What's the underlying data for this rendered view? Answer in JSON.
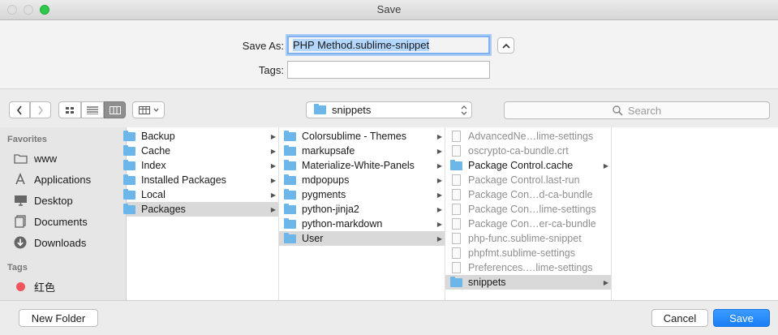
{
  "window": {
    "title": "Save"
  },
  "form": {
    "save_as_label": "Save As:",
    "save_as_value": "PHP Method.sublime-snippet",
    "tags_label": "Tags:",
    "tags_value": ""
  },
  "toolbar": {
    "location": "snippets",
    "search_placeholder": "Search"
  },
  "sidebar": {
    "favorites_header": "Favorites",
    "favorites": [
      {
        "label": "www",
        "icon": "folder-icon"
      },
      {
        "label": "Applications",
        "icon": "applications-icon"
      },
      {
        "label": "Desktop",
        "icon": "desktop-icon"
      },
      {
        "label": "Documents",
        "icon": "documents-icon"
      },
      {
        "label": "Downloads",
        "icon": "downloads-icon"
      }
    ],
    "tags_header": "Tags",
    "tags": [
      {
        "label": "红色",
        "color": "#f2545b"
      }
    ]
  },
  "columns": [
    {
      "items": [
        {
          "label": "Backup",
          "type": "folder"
        },
        {
          "label": "Cache",
          "type": "folder"
        },
        {
          "label": "Index",
          "type": "folder"
        },
        {
          "label": "Installed Packages",
          "type": "folder"
        },
        {
          "label": "Local",
          "type": "folder"
        },
        {
          "label": "Packages",
          "type": "folder",
          "selected": true
        }
      ]
    },
    {
      "items": [
        {
          "label": "Colorsublime - Themes",
          "type": "folder"
        },
        {
          "label": "markupsafe",
          "type": "folder"
        },
        {
          "label": "Materialize-White-Panels",
          "type": "folder"
        },
        {
          "label": "mdpopups",
          "type": "folder"
        },
        {
          "label": "pygments",
          "type": "folder"
        },
        {
          "label": "python-jinja2",
          "type": "folder"
        },
        {
          "label": "python-markdown",
          "type": "folder"
        },
        {
          "label": "User",
          "type": "folder",
          "selected": true
        }
      ]
    },
    {
      "items": [
        {
          "label": "AdvancedNe…lime-settings",
          "type": "file"
        },
        {
          "label": "oscrypto-ca-bundle.crt",
          "type": "file"
        },
        {
          "label": "Package Control.cache",
          "type": "folder"
        },
        {
          "label": "Package Control.last-run",
          "type": "file"
        },
        {
          "label": "Package Con…d-ca-bundle",
          "type": "file"
        },
        {
          "label": "Package Con…lime-settings",
          "type": "file"
        },
        {
          "label": "Package Con…er-ca-bundle",
          "type": "file"
        },
        {
          "label": "php-func.sublime-snippet",
          "type": "file"
        },
        {
          "label": "phpfmt.sublime-settings",
          "type": "file"
        },
        {
          "label": "Preferences.…lime-settings",
          "type": "file"
        },
        {
          "label": "snippets",
          "type": "folder",
          "selected": true
        }
      ]
    }
  ],
  "buttons": {
    "new_folder": "New Folder",
    "cancel": "Cancel",
    "save": "Save"
  },
  "colors": {
    "accent": "#1a8cff",
    "folder": "#6db6ea",
    "selection": "#d9d9d9"
  }
}
